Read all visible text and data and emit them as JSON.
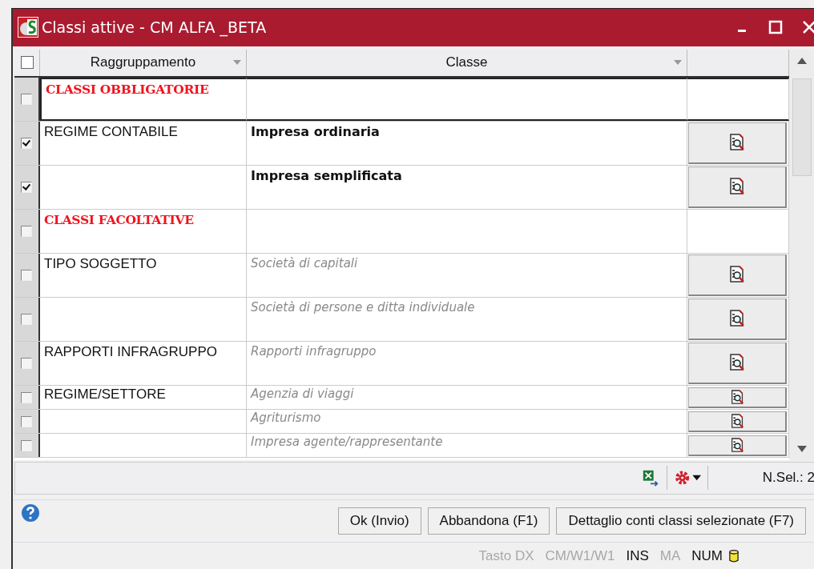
{
  "window": {
    "title": "Classi attive - CM ALFA _BETA"
  },
  "table": {
    "all_checked": false,
    "columns": [
      "Raggruppamento",
      "Classe"
    ],
    "rows": [
      {
        "kind": "section",
        "group": "CLASSI OBBLIGATORIE",
        "class": "",
        "checked": false,
        "selected": true,
        "compact": false
      },
      {
        "kind": "active",
        "group": "REGIME CONTABILE",
        "class": "Impresa ordinaria",
        "checked": true,
        "selected": false,
        "compact": false
      },
      {
        "kind": "active",
        "group": "",
        "class": "Impresa semplificata",
        "checked": true,
        "selected": false,
        "compact": false
      },
      {
        "kind": "section",
        "group": "CLASSI FACOLTATIVE",
        "class": "",
        "checked": false,
        "selected": false,
        "compact": false
      },
      {
        "kind": "inactive",
        "group": "TIPO SOGGETTO",
        "class": "Società di capitali",
        "checked": false,
        "selected": false,
        "compact": false
      },
      {
        "kind": "inactive",
        "group": "",
        "class": "Società di persone e ditta individuale",
        "checked": false,
        "selected": false,
        "compact": false
      },
      {
        "kind": "inactive",
        "group": "RAPPORTI INFRAGRUPPO",
        "class": "Rapporti infragruppo",
        "checked": false,
        "selected": false,
        "compact": false
      },
      {
        "kind": "inactive",
        "group": "REGIME/SETTORE",
        "class": "Agenzia di viaggi",
        "checked": false,
        "selected": false,
        "compact": true
      },
      {
        "kind": "inactive",
        "group": "",
        "class": "Agriturismo",
        "checked": false,
        "selected": false,
        "compact": true
      },
      {
        "kind": "inactive",
        "group": "",
        "class": "Impresa agente/rappresentante",
        "checked": false,
        "selected": false,
        "compact": true
      }
    ]
  },
  "toolbar": {
    "selection_count": "N.Sel.: 2"
  },
  "buttons": [
    "Ok (Invio)",
    "Abbandona (F1)",
    "Dettaglio conti classi selezionate (F7)"
  ],
  "status_bar": [
    {
      "label": "Tasto DX",
      "on": false
    },
    {
      "label": "CM/W1/W1",
      "on": false
    },
    {
      "label": "INS",
      "on": true
    },
    {
      "label": "MA",
      "on": false
    },
    {
      "label": "NUM",
      "on": true
    }
  ]
}
